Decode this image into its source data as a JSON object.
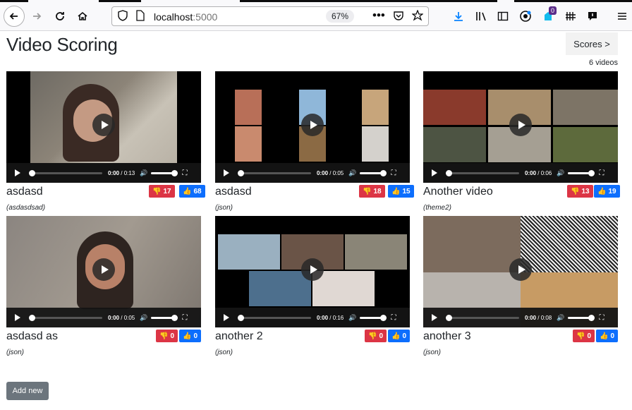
{
  "browser": {
    "url_host": "localhost",
    "url_port": ":5000",
    "zoom": "67%",
    "notification_count": "0"
  },
  "page": {
    "title": "Video Scoring",
    "scores_button": "Scores >",
    "video_count": "6 videos",
    "add_button": "Add new"
  },
  "videos": [
    {
      "title": "asdasd",
      "theme": "(asdasdsad)",
      "down": "17",
      "up": "68",
      "current": "0:00",
      "duration": "0:13"
    },
    {
      "title": "asdasd",
      "theme": "(json)",
      "down": "18",
      "up": "15",
      "current": "0:00",
      "duration": "0:05"
    },
    {
      "title": "Another video",
      "theme": "(theme2)",
      "down": "13",
      "up": "19",
      "current": "0:00",
      "duration": "0:06"
    },
    {
      "title": "asdasd as",
      "theme": "(json)",
      "down": "0",
      "up": "0",
      "current": "0:00",
      "duration": "0:05"
    },
    {
      "title": "another 2",
      "theme": "(json)",
      "down": "0",
      "up": "0",
      "current": "0:00",
      "duration": "0:16"
    },
    {
      "title": "another 3",
      "theme": "(json)",
      "down": "0",
      "up": "0",
      "current": "0:00",
      "duration": "0:08"
    }
  ],
  "colors": {
    "dislike": "#dc3545",
    "like": "#0d6efd",
    "add_button": "#6c757d"
  }
}
